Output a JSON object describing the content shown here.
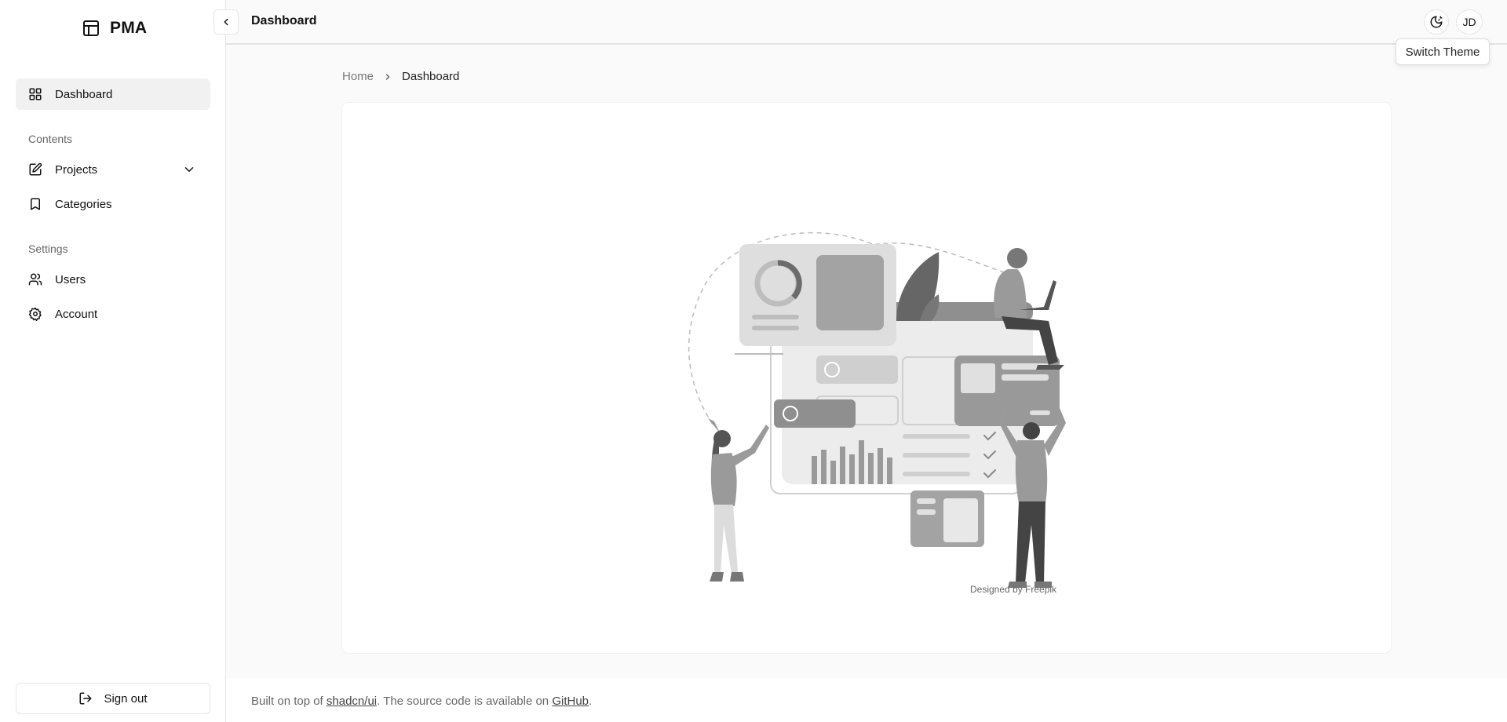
{
  "app": {
    "name": "PMA"
  },
  "header": {
    "title": "Dashboard",
    "avatar_initials": "JD",
    "theme_tooltip": "Switch Theme"
  },
  "sidebar": {
    "items": [
      {
        "label": "Dashboard",
        "icon": "layout-grid-icon",
        "active": true
      },
      {
        "section": "Contents"
      },
      {
        "label": "Projects",
        "icon": "edit-icon",
        "has_submenu": true
      },
      {
        "label": "Categories",
        "icon": "bookmark-icon"
      },
      {
        "section": "Settings"
      },
      {
        "label": "Users",
        "icon": "users-icon"
      },
      {
        "label": "Account",
        "icon": "gear-icon"
      }
    ],
    "sections": {
      "contents": "Contents",
      "settings": "Settings"
    },
    "dashboard": "Dashboard",
    "projects": "Projects",
    "categories": "Categories",
    "users": "Users",
    "account": "Account",
    "signout": "Sign out"
  },
  "breadcrumb": {
    "home": "Home",
    "current": "Dashboard"
  },
  "main": {
    "credit": "Designed by Freepik"
  },
  "footer": {
    "prefix": "Built on top of ",
    "link1": "shadcn/ui",
    "middle": ". The source code is available on ",
    "link2": "GitHub",
    "suffix": "."
  },
  "colors": {
    "active_bg": "#f1f1f2",
    "border": "#e5e5e5",
    "muted_text": "#666666"
  }
}
